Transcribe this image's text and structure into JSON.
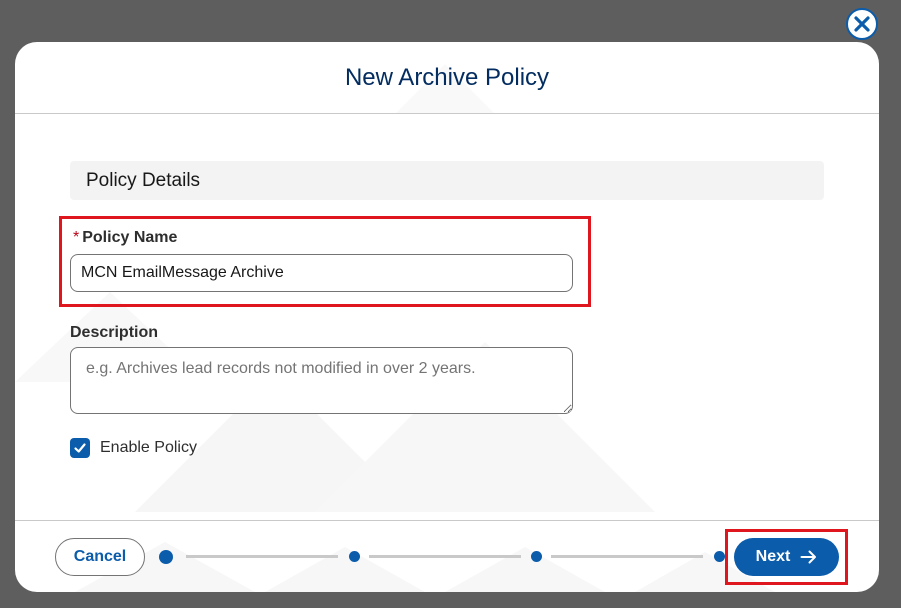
{
  "modal": {
    "title": "New Archive Policy",
    "close_icon": "close-icon"
  },
  "section": {
    "title": "Policy Details"
  },
  "policy_name": {
    "required_marker": "*",
    "label": "Policy Name",
    "value": "MCN EmailMessage Archive"
  },
  "description": {
    "label": "Description",
    "placeholder": "e.g. Archives lead records not modified in over 2 years.",
    "value": ""
  },
  "enable_policy": {
    "label": "Enable Policy",
    "checked": true
  },
  "footer": {
    "cancel_label": "Cancel",
    "next_label": "Next",
    "next_icon": "arrow-right-icon",
    "progress_steps": 4,
    "current_step": 1
  },
  "colors": {
    "brand": "#0b5cab",
    "title": "#032d60",
    "highlight": "#e0161f",
    "required": "#ba0517"
  }
}
